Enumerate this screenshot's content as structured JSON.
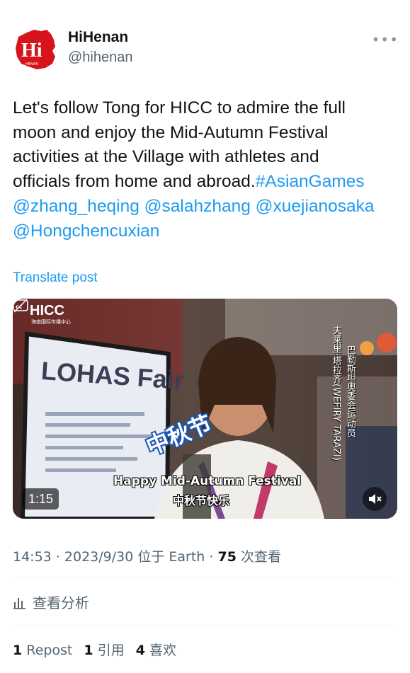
{
  "author": {
    "display_name": "HiHenan",
    "handle": "@hihenan",
    "avatar_icon": "hihenan-logo",
    "avatar_color": "#d7141c"
  },
  "post": {
    "line1": "Let's follow Tong for HICC to admire the full",
    "line2": "moon and enjoy the Mid-Autumn Festival",
    "line3": "activities at the Village with athletes and",
    "line4_text": "officials from home and abroad.",
    "hashtag": "#AsianGames",
    "mention1": "@zhang_heqing",
    "mention2": "@salahzhang",
    "mention3": "@xuejianosaka",
    "mention4": "@Hongchencuxian"
  },
  "translate_label": "Translate post",
  "media": {
    "duration": "1:15",
    "hicc_logo": "HICC",
    "hicc_sub": "海南国际传播中心",
    "booth_sign": "LOHAS Fair",
    "sign_zh": "中秋节",
    "caption_en": "Happy Mid-Autumn Festival",
    "caption_zh": "中秋节快乐",
    "vertical_name": "夫莱里·塔拉齐(WEFIRY TARAZI)",
    "vertical_title": "巴勒斯坦奥委会运动员",
    "cc_icon": "closed-captions-icon",
    "mute_icon": "volume-muted-icon"
  },
  "meta": {
    "time": "14:53",
    "date": "2023/9/30",
    "location": "位于 Earth",
    "views_count": "75",
    "views_label": "次查看"
  },
  "analytics_label": "查看分析",
  "stats": {
    "reposts_count": "1",
    "reposts_label": "Repost",
    "quotes_count": "1",
    "quotes_label": "引用",
    "likes_count": "4",
    "likes_label": "喜欢"
  },
  "colors": {
    "link": "#1d9bf0",
    "secondary_text": "#536471",
    "primary_text": "#0f1419"
  }
}
